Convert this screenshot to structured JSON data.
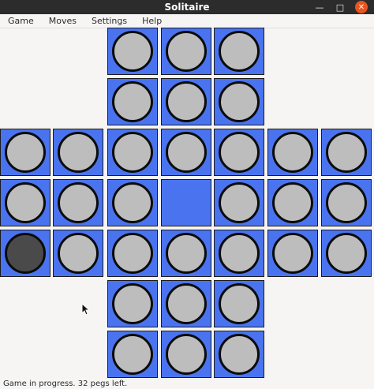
{
  "window": {
    "title": "Solitaire"
  },
  "menu": [
    "Game",
    "Moves",
    "Settings",
    "Help"
  ],
  "status": "Game in progress. 32 pegs left.",
  "colors": {
    "hole": "#4a74ef",
    "peg": "#bdbdbd",
    "selected_peg": "#4a4a4a",
    "titlebar": "#2c2c2c"
  },
  "board": {
    "rows": [
      [
        "none",
        "none",
        "peg",
        "peg",
        "peg",
        "none",
        "none"
      ],
      [
        "none",
        "none",
        "peg",
        "peg",
        "peg",
        "none",
        "none"
      ],
      [
        "peg",
        "peg",
        "peg",
        "peg",
        "peg",
        "peg",
        "peg"
      ],
      [
        "peg",
        "peg",
        "peg",
        "empty",
        "peg",
        "peg",
        "peg"
      ],
      [
        "selected",
        "peg",
        "peg",
        "peg",
        "peg",
        "peg",
        "peg"
      ],
      [
        "none",
        "none",
        "peg",
        "peg",
        "peg",
        "none",
        "none"
      ],
      [
        "none",
        "none",
        "peg",
        "peg",
        "peg",
        "none",
        "none"
      ]
    ]
  }
}
